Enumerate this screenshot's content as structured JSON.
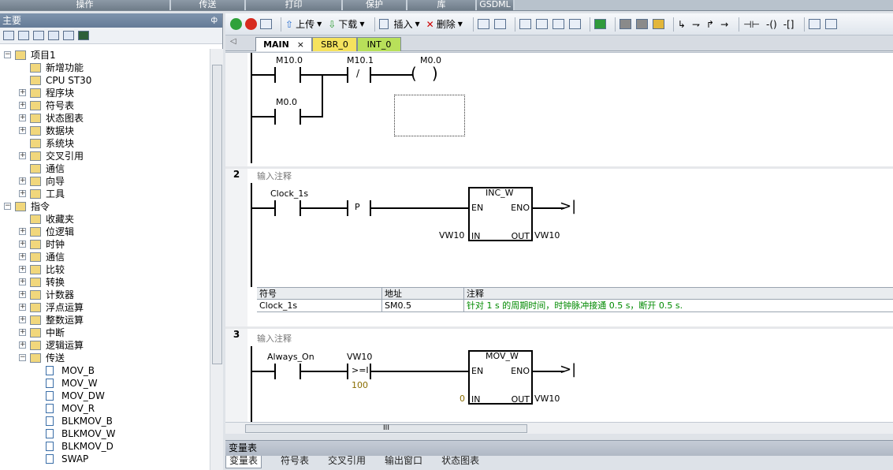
{
  "topbar": {
    "tabs": [
      "操作",
      "传送",
      "打印",
      "保护",
      "库",
      "GSDML"
    ]
  },
  "left_pane": {
    "title": "主要",
    "pin": "ф",
    "tree": [
      {
        "label": "项目1",
        "indent": 0,
        "expander": "−"
      },
      {
        "label": "新增功能",
        "indent": 1,
        "expander": ""
      },
      {
        "label": "CPU ST30",
        "indent": 1,
        "expander": ""
      },
      {
        "label": "程序块",
        "indent": 1,
        "expander": "+"
      },
      {
        "label": "符号表",
        "indent": 1,
        "expander": "+"
      },
      {
        "label": "状态图表",
        "indent": 1,
        "expander": "+"
      },
      {
        "label": "数据块",
        "indent": 1,
        "expander": "+"
      },
      {
        "label": "系统块",
        "indent": 1,
        "expander": ""
      },
      {
        "label": "交叉引用",
        "indent": 1,
        "expander": "+"
      },
      {
        "label": "通信",
        "indent": 1,
        "expander": ""
      },
      {
        "label": "向导",
        "indent": 1,
        "expander": "+"
      },
      {
        "label": "工具",
        "indent": 1,
        "expander": "+"
      },
      {
        "label": "指令",
        "indent": 0,
        "expander": "−"
      },
      {
        "label": "收藏夹",
        "indent": 1,
        "expander": ""
      },
      {
        "label": "位逻辑",
        "indent": 1,
        "expander": "+"
      },
      {
        "label": "时钟",
        "indent": 1,
        "expander": "+"
      },
      {
        "label": "通信",
        "indent": 1,
        "expander": "+"
      },
      {
        "label": "比较",
        "indent": 1,
        "expander": "+"
      },
      {
        "label": "转换",
        "indent": 1,
        "expander": "+"
      },
      {
        "label": "计数器",
        "indent": 1,
        "expander": "+"
      },
      {
        "label": "浮点运算",
        "indent": 1,
        "expander": "+"
      },
      {
        "label": "整数运算",
        "indent": 1,
        "expander": "+"
      },
      {
        "label": "中断",
        "indent": 1,
        "expander": "+"
      },
      {
        "label": "逻辑运算",
        "indent": 1,
        "expander": "+"
      },
      {
        "label": "传送",
        "indent": 1,
        "expander": "−"
      },
      {
        "label": "MOV_B",
        "indent": 2,
        "expander": ""
      },
      {
        "label": "MOV_W",
        "indent": 2,
        "expander": ""
      },
      {
        "label": "MOV_DW",
        "indent": 2,
        "expander": ""
      },
      {
        "label": "MOV_R",
        "indent": 2,
        "expander": ""
      },
      {
        "label": "BLKMOV_B",
        "indent": 2,
        "expander": ""
      },
      {
        "label": "BLKMOV_W",
        "indent": 2,
        "expander": ""
      },
      {
        "label": "BLKMOV_D",
        "indent": 2,
        "expander": ""
      },
      {
        "label": "SWAP",
        "indent": 2,
        "expander": ""
      }
    ]
  },
  "toolbar": {
    "upload": "上传",
    "download": "下载",
    "insert": "插入",
    "delete": "删除"
  },
  "program_tabs": [
    "MAIN",
    "SBR_0",
    "INT_0"
  ],
  "program_tab_close": "×",
  "network1": {
    "contacts": [
      "M10.0",
      "M10.1",
      "M0.0"
    ],
    "branch_contact": "M0.0",
    "coil": "M0.0",
    "contact_nc": "/"
  },
  "network2": {
    "number": "2",
    "comment": "输入注释",
    "contact": "Clock_1s",
    "pulse": "P",
    "box": "INC_W",
    "en": "EN",
    "eno": "ENO",
    "in_label": "IN",
    "out_label": "OUT",
    "in_val": "VW10",
    "out_val": "VW10"
  },
  "symbol_table": {
    "headers": [
      "符号",
      "地址",
      "注释"
    ],
    "row": [
      "Clock_1s",
      "SM0.5",
      "针对 1 s 的周期时间，时钟脉冲接通 0.5 s，断开 0.5 s."
    ]
  },
  "network3": {
    "number": "3",
    "comment": "输入注释",
    "contact": "Always_On",
    "cmp_top": "VW10",
    "cmp_op": ">=I",
    "cmp_bottom": "100",
    "box": "MOV_W",
    "en": "EN",
    "eno": "ENO",
    "in_label": "IN",
    "out_label": "OUT",
    "in_val": "0",
    "out_val": "VW10"
  },
  "hscroll_label": "III",
  "var_pane": "变量表",
  "bottom_tabs": [
    "变量表",
    "符号表",
    "交叉引用",
    "输出窗口",
    "状态图表"
  ]
}
